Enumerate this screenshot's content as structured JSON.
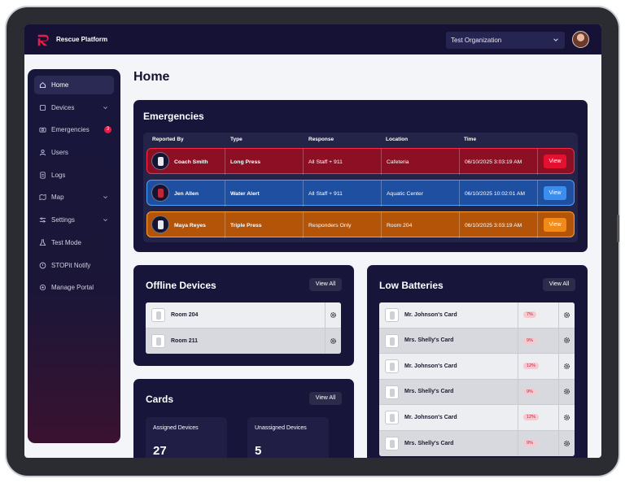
{
  "app": {
    "brand": "Rescue Platform",
    "organization": "Test Organization"
  },
  "page": {
    "title": "Home"
  },
  "colors": {
    "topbar": "#161236",
    "panel": "#17153a",
    "accent_red": "#e11d48",
    "accent_blue": "#3b82f6",
    "accent_orange": "#f59e0b"
  },
  "sidebar": {
    "items": [
      {
        "label": "Home",
        "icon": "home-icon",
        "active": true
      },
      {
        "label": "Devices",
        "icon": "devices-icon",
        "chevron": true
      },
      {
        "label": "Emergencies",
        "icon": "emergencies-icon",
        "badge": "3"
      },
      {
        "label": "Users",
        "icon": "users-icon"
      },
      {
        "label": "Logs",
        "icon": "logs-icon"
      },
      {
        "label": "Map",
        "icon": "map-icon",
        "chevron": true
      },
      {
        "label": "Settings",
        "icon": "settings-icon",
        "chevron": true
      },
      {
        "label": "Test Mode",
        "icon": "test-mode-icon"
      },
      {
        "label": "STOPit Notify",
        "icon": "notify-icon"
      },
      {
        "label": "Manage Portal",
        "icon": "manage-portal-icon"
      }
    ]
  },
  "emergencies": {
    "title": "Emergencies",
    "columns": [
      "Reported By",
      "Type",
      "Response",
      "Location",
      "Time"
    ],
    "rows": [
      {
        "reported_by": "Coach Smith",
        "type": "Long Press",
        "response": "All Staff + 911",
        "location": "Cafeteria",
        "time": "06/10/2025 3:03:19 AM",
        "action": "View",
        "color": "red"
      },
      {
        "reported_by": "Jen Allen",
        "type": "Water Alert",
        "response": "All Staff + 911",
        "location": "Aquatic Center",
        "time": "06/10/2025 10:02:01 AM",
        "action": "View",
        "color": "blue"
      },
      {
        "reported_by": "Maya Reyes",
        "type": "Triple Press",
        "response": "Responders Only",
        "location": "Room 204",
        "time": "06/10/2025 3:03:19 AM",
        "action": "View",
        "color": "orange"
      }
    ]
  },
  "offline_devices": {
    "title": "Offline Devices",
    "view_all": "View All",
    "items": [
      {
        "label": "Room 204"
      },
      {
        "label": "Room 211"
      }
    ]
  },
  "low_batteries": {
    "title": "Low Batteries",
    "view_all": "View All",
    "items": [
      {
        "label": "Mr. Johnson's Card",
        "percent": "7%"
      },
      {
        "label": "Mrs. Shelly's Card",
        "percent": "9%"
      },
      {
        "label": "Mr. Johnson's Card",
        "percent": "12%"
      },
      {
        "label": "Mrs. Shelly's Card",
        "percent": "9%"
      },
      {
        "label": "Mr. Johnson's Card",
        "percent": "12%"
      },
      {
        "label": "Mrs. Shelly's Card",
        "percent": "9%"
      }
    ]
  },
  "cards": {
    "title": "Cards",
    "view_all": "View All",
    "assigned": {
      "label": "Assigned Devices",
      "value": "27"
    },
    "unassigned": {
      "label": "Unassigned Devices",
      "value": "5"
    }
  }
}
